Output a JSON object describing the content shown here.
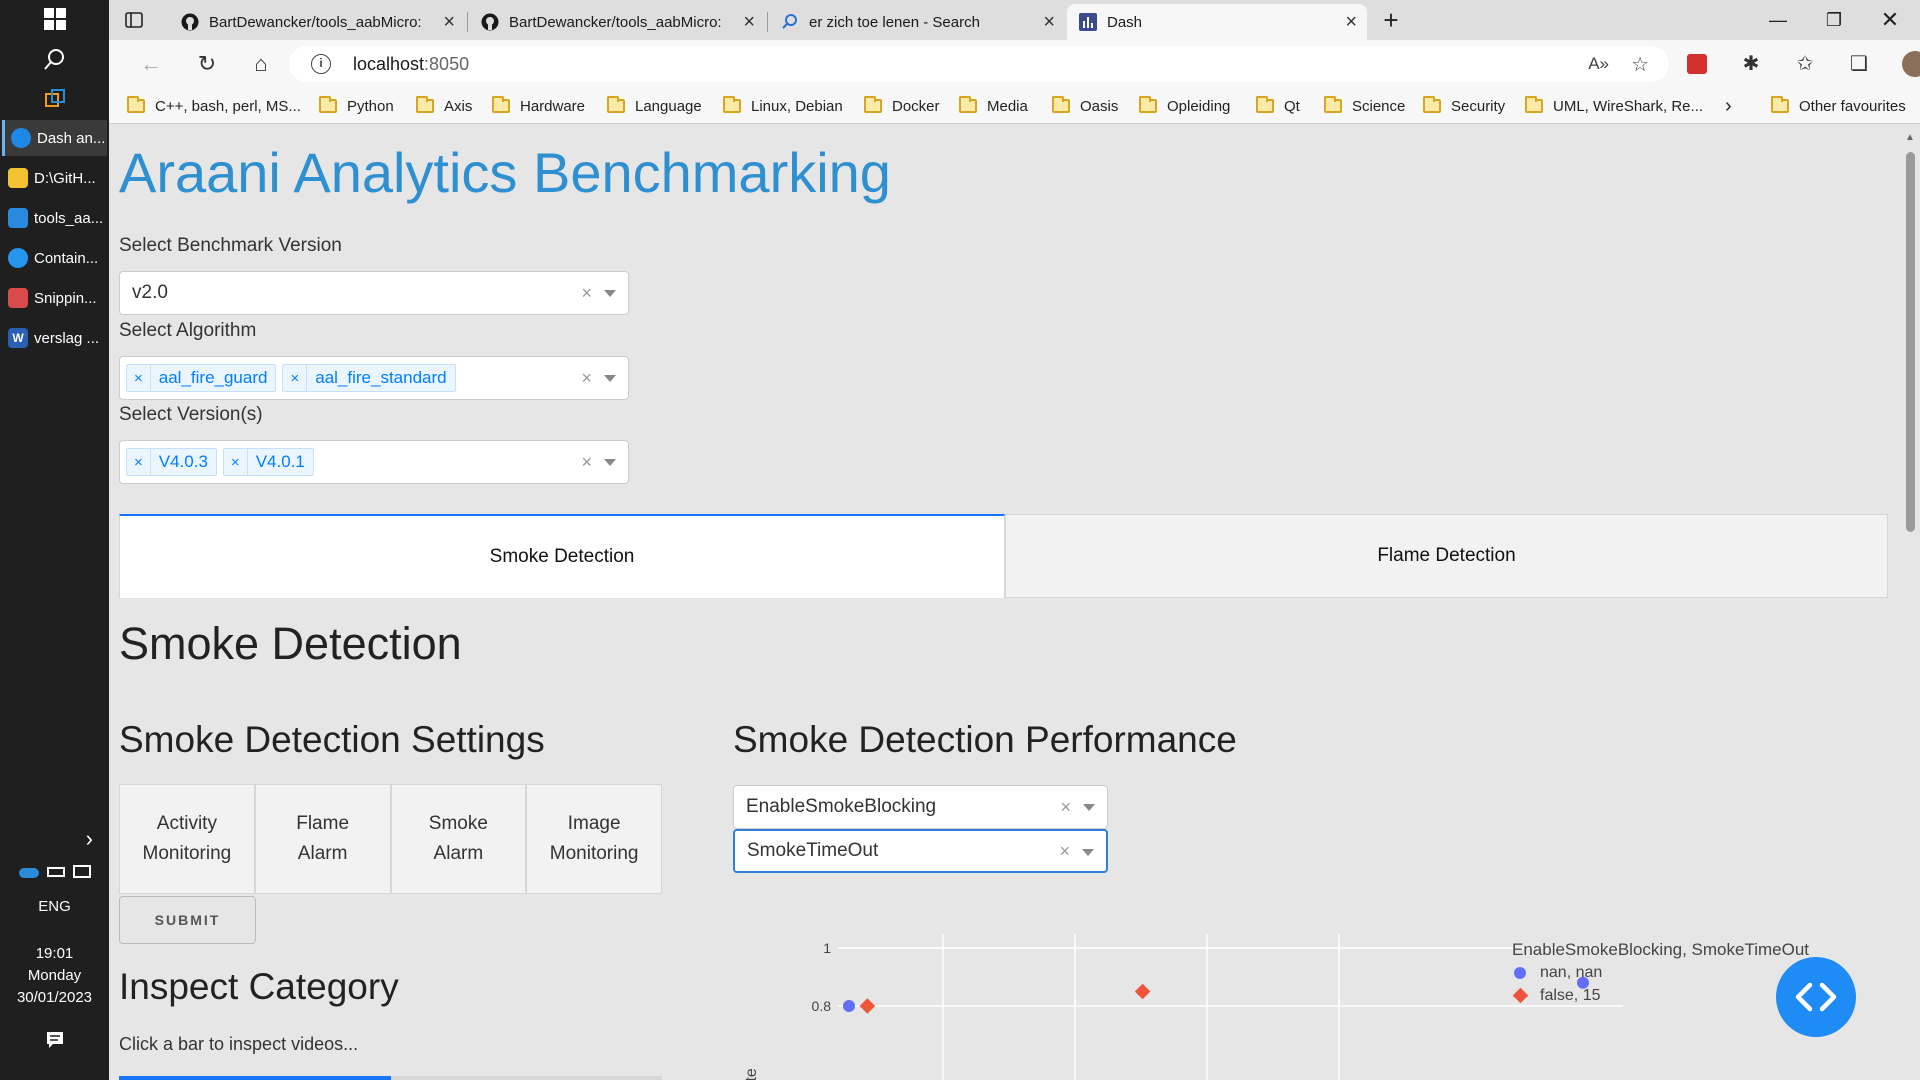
{
  "taskbar": {
    "apps": [
      {
        "label": "Dash an...",
        "color": "#1e88e5",
        "active": true
      },
      {
        "label": "D:\\GitH...",
        "color": "#f2c230",
        "active": false
      },
      {
        "label": "tools_aa...",
        "color": "#2b8ae0",
        "active": false
      },
      {
        "label": "Contain...",
        "color": "#2496ed",
        "active": false
      },
      {
        "label": "Snippin...",
        "color": "#d94b4b",
        "active": false
      },
      {
        "label": "verslag ...",
        "color": "#2b5fb4",
        "active": false
      }
    ],
    "language": "ENG",
    "time": "19:01",
    "day": "Monday",
    "date": "30/01/2023"
  },
  "browser": {
    "tabs": [
      {
        "title": "BartDewancker/tools_aabMicro:",
        "icon": "github-icon"
      },
      {
        "title": "BartDewancker/tools_aabMicro:",
        "icon": "github-icon"
      },
      {
        "title": "er zich toe lenen - Search",
        "icon": "search-icon"
      },
      {
        "title": "Dash",
        "icon": "dash-icon"
      }
    ],
    "url_host": "localhost",
    "url_port": ":8050",
    "bookmarks": [
      "C++, bash, perl, MS...",
      "Python",
      "Axis",
      "Hardware",
      "Language",
      "Linux, Debian",
      "Docker",
      "Media",
      "Oasis",
      "Opleiding",
      "Qt",
      "Science",
      "Security",
      "UML, WireShark, Re..."
    ],
    "other_favourites": "Other favourites"
  },
  "page": {
    "title": "Araani Analytics Benchmarking",
    "benchmark_label": "Select Benchmark Version",
    "benchmark_value": "v2.0",
    "algorithm_label": "Select Algorithm",
    "algorithms": [
      "aal_fire_guard",
      "aal_fire_standard"
    ],
    "versions_label": "Select Version(s)",
    "versions": [
      "V4.0.3",
      "V4.0.1"
    ],
    "clear_symbol": "×",
    "tabs": [
      "Smoke Detection",
      "Flame Detection"
    ],
    "section_title": "Smoke Detection",
    "settings_title": "Smoke Detection Settings",
    "settings_tabs": [
      {
        "line1": "Activity",
        "line2": "Monitoring"
      },
      {
        "line1": "Flame",
        "line2": "Alarm"
      },
      {
        "line1": "Smoke",
        "line2": "Alarm"
      },
      {
        "line1": "Image",
        "line2": "Monitoring"
      }
    ],
    "submit_label": "SUBMIT",
    "inspect_title": "Inspect Category",
    "inspect_hint": "Click a bar to inspect videos...",
    "performance_title": "Smoke Detection Performance",
    "param1": "EnableSmokeBlocking",
    "param2": "SmokeTimeOut"
  },
  "chart_data": {
    "type": "scatter",
    "ylabel": "Rate",
    "y_ticks": [
      0.8,
      1
    ],
    "legend_title": "EnableSmokeBlocking, SmokeTimeOut",
    "series": [
      {
        "name": "nan, nan",
        "color": "#636efa",
        "marker": "circle",
        "points": [
          {
            "x": 0,
            "y": 0.8
          },
          {
            "x": 4,
            "y": 0.88
          }
        ]
      },
      {
        "name": "false, 15",
        "color": "#ef553b",
        "marker": "diamond",
        "points": [
          {
            "x": 0.1,
            "y": 0.8
          },
          {
            "x": 1.6,
            "y": 0.85
          }
        ]
      }
    ]
  },
  "colors": {
    "accent": "#2e8fd1",
    "chip_text": "#007eff",
    "tab_selected": "#1975fa",
    "fab": "#1f8cf5"
  }
}
